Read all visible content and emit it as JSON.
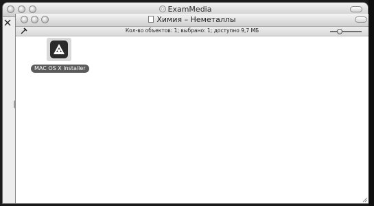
{
  "outer_window": {
    "title": "ExamMedia",
    "icon": "cd-disc-icon"
  },
  "inner_window": {
    "title": "Химия – Неметаллы",
    "icon": "document-icon",
    "status_text": "Кол-во объектов: 1; выбрано: 1; доступно 9,7 МБ",
    "zoom_level": 0.25
  },
  "files": [
    {
      "name": "MAC OS X Installer",
      "icon": "installer-app-icon",
      "selected": true
    }
  ],
  "colors": {
    "window_chrome": "#cdcdcd",
    "selection_label": "#5b5b5b",
    "backdrop": "#1b1b1b"
  }
}
